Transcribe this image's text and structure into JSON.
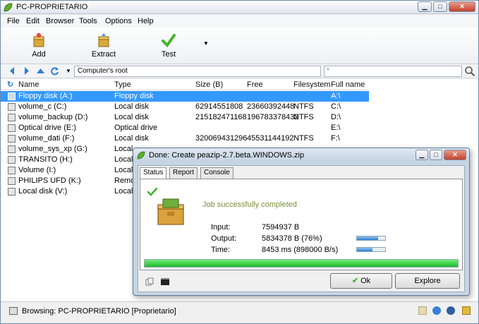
{
  "window": {
    "title": "PC-PROPRIETARIO",
    "controls": [
      "minimize-icon",
      "maximize-icon",
      "close-icon"
    ]
  },
  "menu": [
    "File",
    "Edit",
    "Browser",
    "Tools",
    "Options",
    "Help"
  ],
  "toolbar": {
    "add_label": "Add",
    "extract_label": "Extract",
    "test_label": "Test"
  },
  "nav": {
    "address": "Computer's root",
    "search_placeholder": "*"
  },
  "columns": [
    "Name",
    "Type",
    "Size (B)",
    "Free",
    "Filesystem",
    "Full name"
  ],
  "rows": [
    {
      "name": "Floppy disk (A:)",
      "type": "Floppy disk",
      "size": "",
      "free": "",
      "fs": "",
      "full": "A:\\"
    },
    {
      "name": "volume_c (C:)",
      "type": "Local disk",
      "size": "62914551808",
      "free": "23660392448",
      "fs": "NTFS",
      "full": "C:\\"
    },
    {
      "name": "volume_backup (D:)",
      "type": "Local disk",
      "size": "215182471168",
      "free": "196783378432",
      "fs": "NTFS",
      "full": "D:\\"
    },
    {
      "name": "Optical drive (E:)",
      "type": "Optical drive",
      "size": "",
      "free": "",
      "fs": "",
      "full": "E:\\"
    },
    {
      "name": "volume_dati (F:)",
      "type": "Local disk",
      "size": "320069431296",
      "free": "45531144192",
      "fs": "NTFS",
      "full": "F:\\"
    },
    {
      "name": "volume_sys_xp (G:)",
      "type": "Local",
      "size": "",
      "free": "",
      "fs": "",
      "full": ""
    },
    {
      "name": "TRANSITO (H:)",
      "type": "Local",
      "size": "",
      "free": "",
      "fs": "",
      "full": ""
    },
    {
      "name": "Volume (I:)",
      "type": "Local",
      "size": "",
      "free": "",
      "fs": "",
      "full": ""
    },
    {
      "name": "PHILIPS UFD (K:)",
      "type": "Remo",
      "size": "",
      "free": "",
      "fs": "",
      "full": ""
    },
    {
      "name": "Local disk (V:)",
      "type": "Local",
      "size": "",
      "free": "",
      "fs": "",
      "full": ""
    }
  ],
  "status": {
    "text": "Browsing: PC-PROPRIETARIO [Proprietario]"
  },
  "dialog": {
    "title": "Done: Create peazip-2.7.beta.WINDOWS.zip",
    "tabs": [
      "Status",
      "Report",
      "Console"
    ],
    "message": "Job successfully completed",
    "input_label": "Input:",
    "input_value": "7594937 B",
    "output_label": "Output:",
    "output_value": "5834378 B (76%)",
    "time_label": "Time:",
    "time_value": "8453 ms (898000 B/s)",
    "output_ratio": 0.76,
    "time_ratio": 0.55,
    "progress": 1.0,
    "ok_label": "Ok",
    "explore_label": "Explore"
  },
  "colors": {
    "selection": "#3399ff",
    "success_text": "#7b8e3c",
    "progress_green": "#1db82b"
  }
}
